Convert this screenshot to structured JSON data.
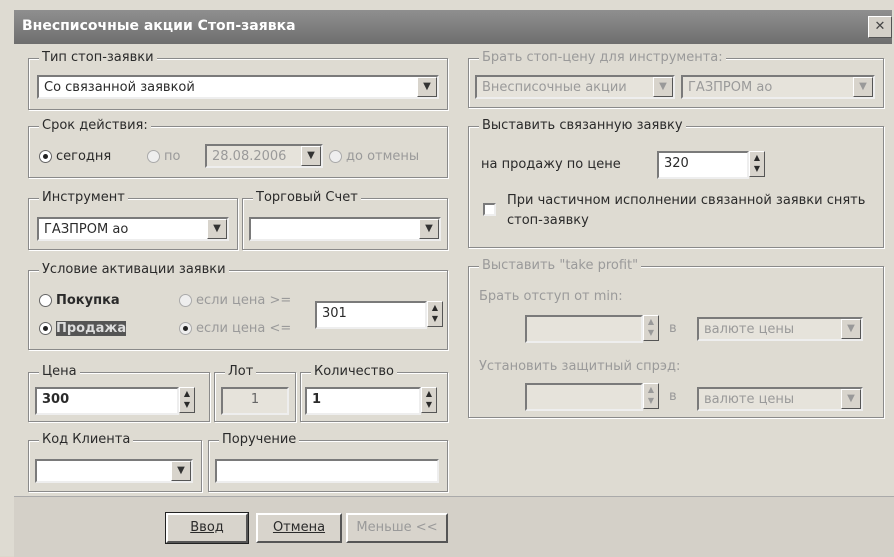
{
  "title": "Внесписочные акции Стоп-заявка",
  "close": "✕",
  "stop_type": {
    "legend": "Тип стоп-заявки",
    "value": "Со связанной заявкой"
  },
  "validity": {
    "legend": "Срок действия:",
    "today": "сегодня",
    "until": "по",
    "date": "28.08.2006",
    "until_cancel": "до отмены"
  },
  "instrument": {
    "legend": "Инструмент",
    "value": "ГАЗПРОМ ао"
  },
  "account": {
    "legend": "Торговый Счет",
    "value": ""
  },
  "activation": {
    "legend": "Условие активации заявки",
    "buy": "Покупка",
    "sell": "Продажа",
    "if_ge": "если цена >=",
    "if_le": "если цена <=",
    "price": "301"
  },
  "price": {
    "legend": "Цена",
    "value": "300"
  },
  "lot": {
    "legend": "Лот",
    "value": "1"
  },
  "qty": {
    "legend": "Количество",
    "value": "1"
  },
  "client": {
    "legend": "Код Клиента",
    "value": ""
  },
  "order": {
    "legend": "Поручение",
    "value": ""
  },
  "stop_instr": {
    "legend": "Брать стоп-цену для инструмента:",
    "class": "Внесписочные акции",
    "sec": "ГАЗПРОМ ао"
  },
  "linked": {
    "legend": "Выставить связанную заявку",
    "label": "на продажу по цене",
    "price": "320",
    "checkbox": "При частичном исполнении связанной заявки снять стоп-заявку"
  },
  "take_profit": {
    "legend": "Выставить \"take profit\"",
    "offset_label": "Брать отступ от min:",
    "in1": "в",
    "unit1": "валюте цены",
    "spread_label": "Установить защитный спрэд:",
    "in2": "в",
    "unit2": "валюте цены"
  },
  "buttons": {
    "enter": "Ввод",
    "cancel": "Отмена",
    "less": "Меньше <<"
  }
}
